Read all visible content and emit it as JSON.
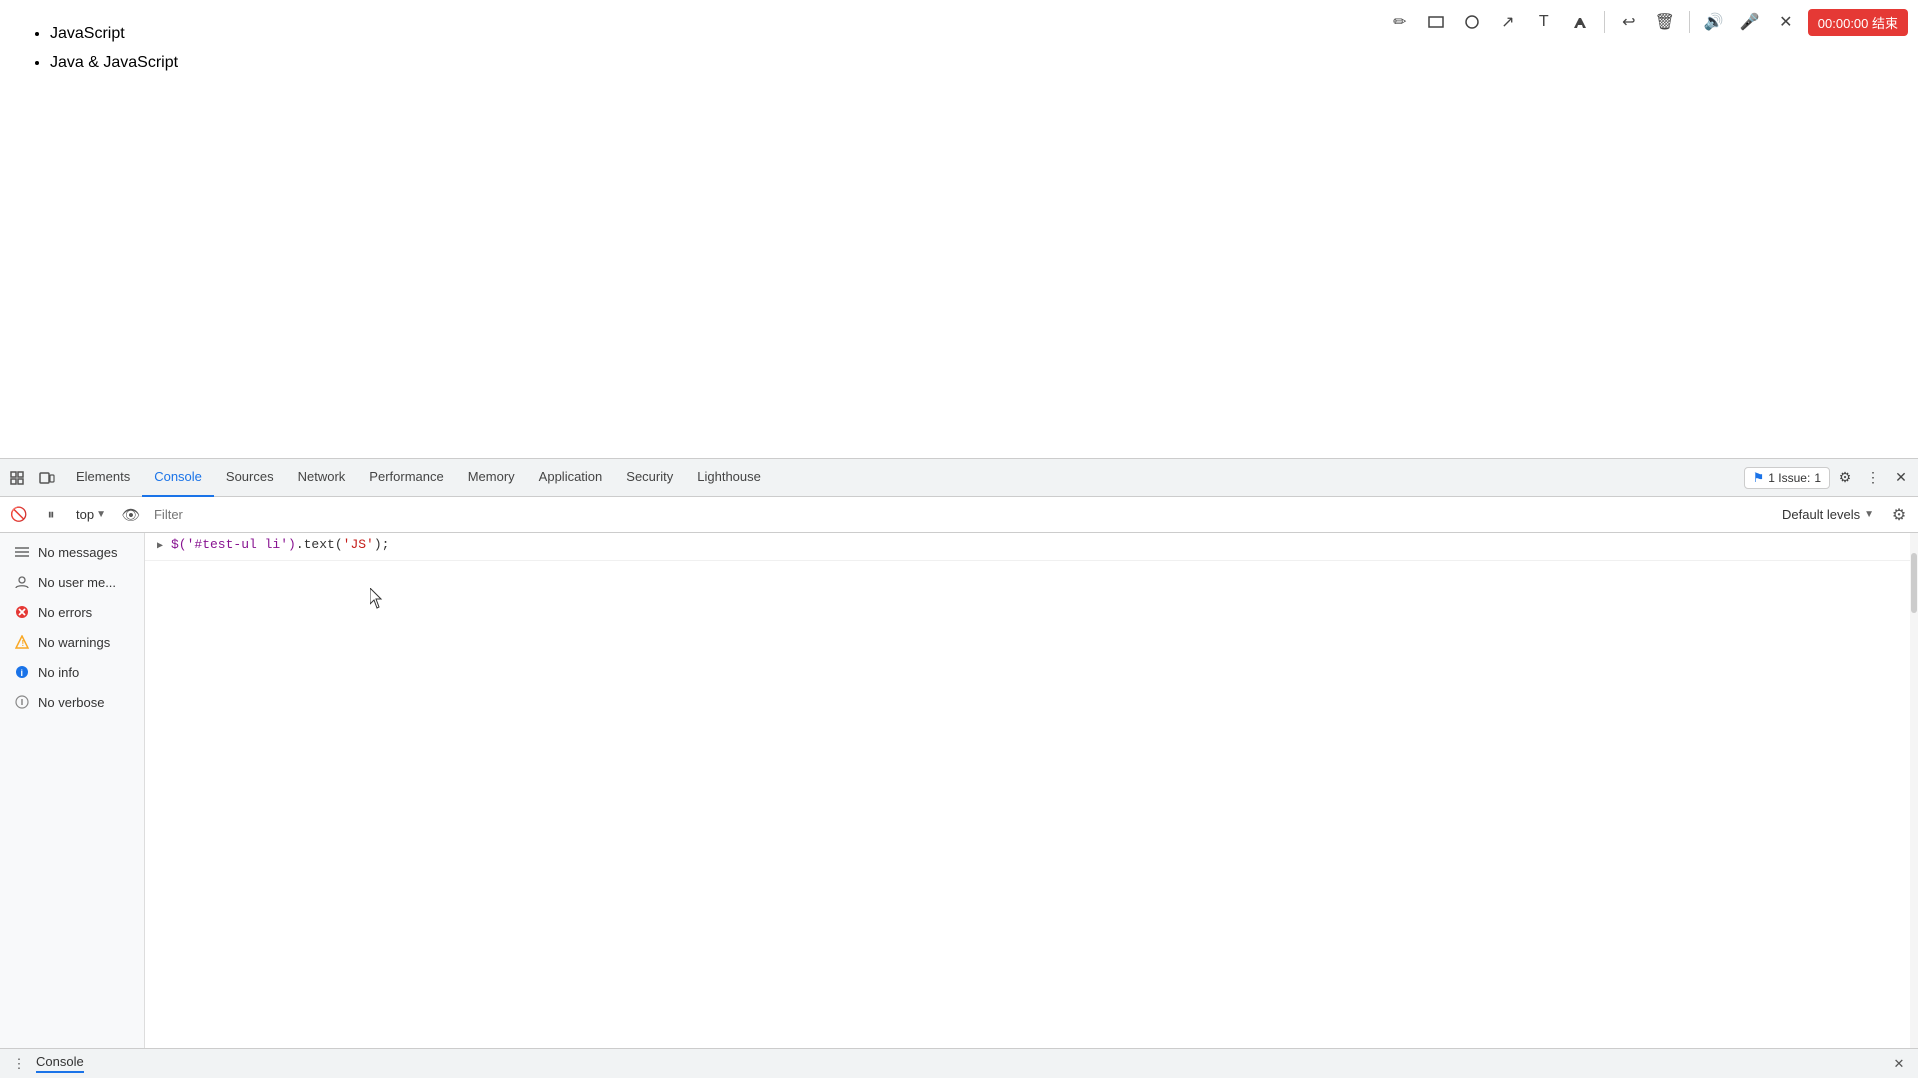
{
  "page": {
    "list_items": [
      "JavaScript",
      "Java & JavaScript"
    ]
  },
  "toolbar": {
    "icons": [
      {
        "name": "pencil-icon",
        "symbol": "✏️"
      },
      {
        "name": "rectangle-icon",
        "symbol": "▭"
      },
      {
        "name": "circle-icon",
        "symbol": "○"
      },
      {
        "name": "arrow-icon",
        "symbol": "↗"
      },
      {
        "name": "text-icon",
        "symbol": "T"
      },
      {
        "name": "highlight-icon",
        "symbol": "✦"
      }
    ],
    "timer_label": "00:00:00 结束",
    "separator": true
  },
  "devtools": {
    "tabs": [
      {
        "label": "Elements",
        "active": false
      },
      {
        "label": "Console",
        "active": true
      },
      {
        "label": "Sources",
        "active": false
      },
      {
        "label": "Network",
        "active": false
      },
      {
        "label": "Performance",
        "active": false
      },
      {
        "label": "Memory",
        "active": false
      },
      {
        "label": "Application",
        "active": false
      },
      {
        "label": "Security",
        "active": false
      },
      {
        "label": "Lighthouse",
        "active": false
      }
    ],
    "issues_badge": "1 Issue:",
    "issues_count": "1"
  },
  "console": {
    "filter_placeholder": "Filter",
    "context_label": "top",
    "default_levels_label": "Default levels",
    "sidebar": {
      "items": [
        {
          "label": "No messages",
          "icon_type": "list"
        },
        {
          "label": "No user me...",
          "icon_type": "user"
        },
        {
          "label": "No errors",
          "icon_type": "error"
        },
        {
          "label": "No warnings",
          "icon_type": "warning"
        },
        {
          "label": "No info",
          "icon_type": "info"
        },
        {
          "label": "No verbose",
          "icon_type": "verbose"
        }
      ]
    },
    "log_entry": {
      "code": "$('#test-ul li').text('JS');",
      "selector": "$('#test-ul li')",
      "method": ".text(",
      "string": "'JS'",
      "closing": ");"
    }
  },
  "bottom_bar": {
    "label": "Console",
    "close_symbol": "✕"
  }
}
